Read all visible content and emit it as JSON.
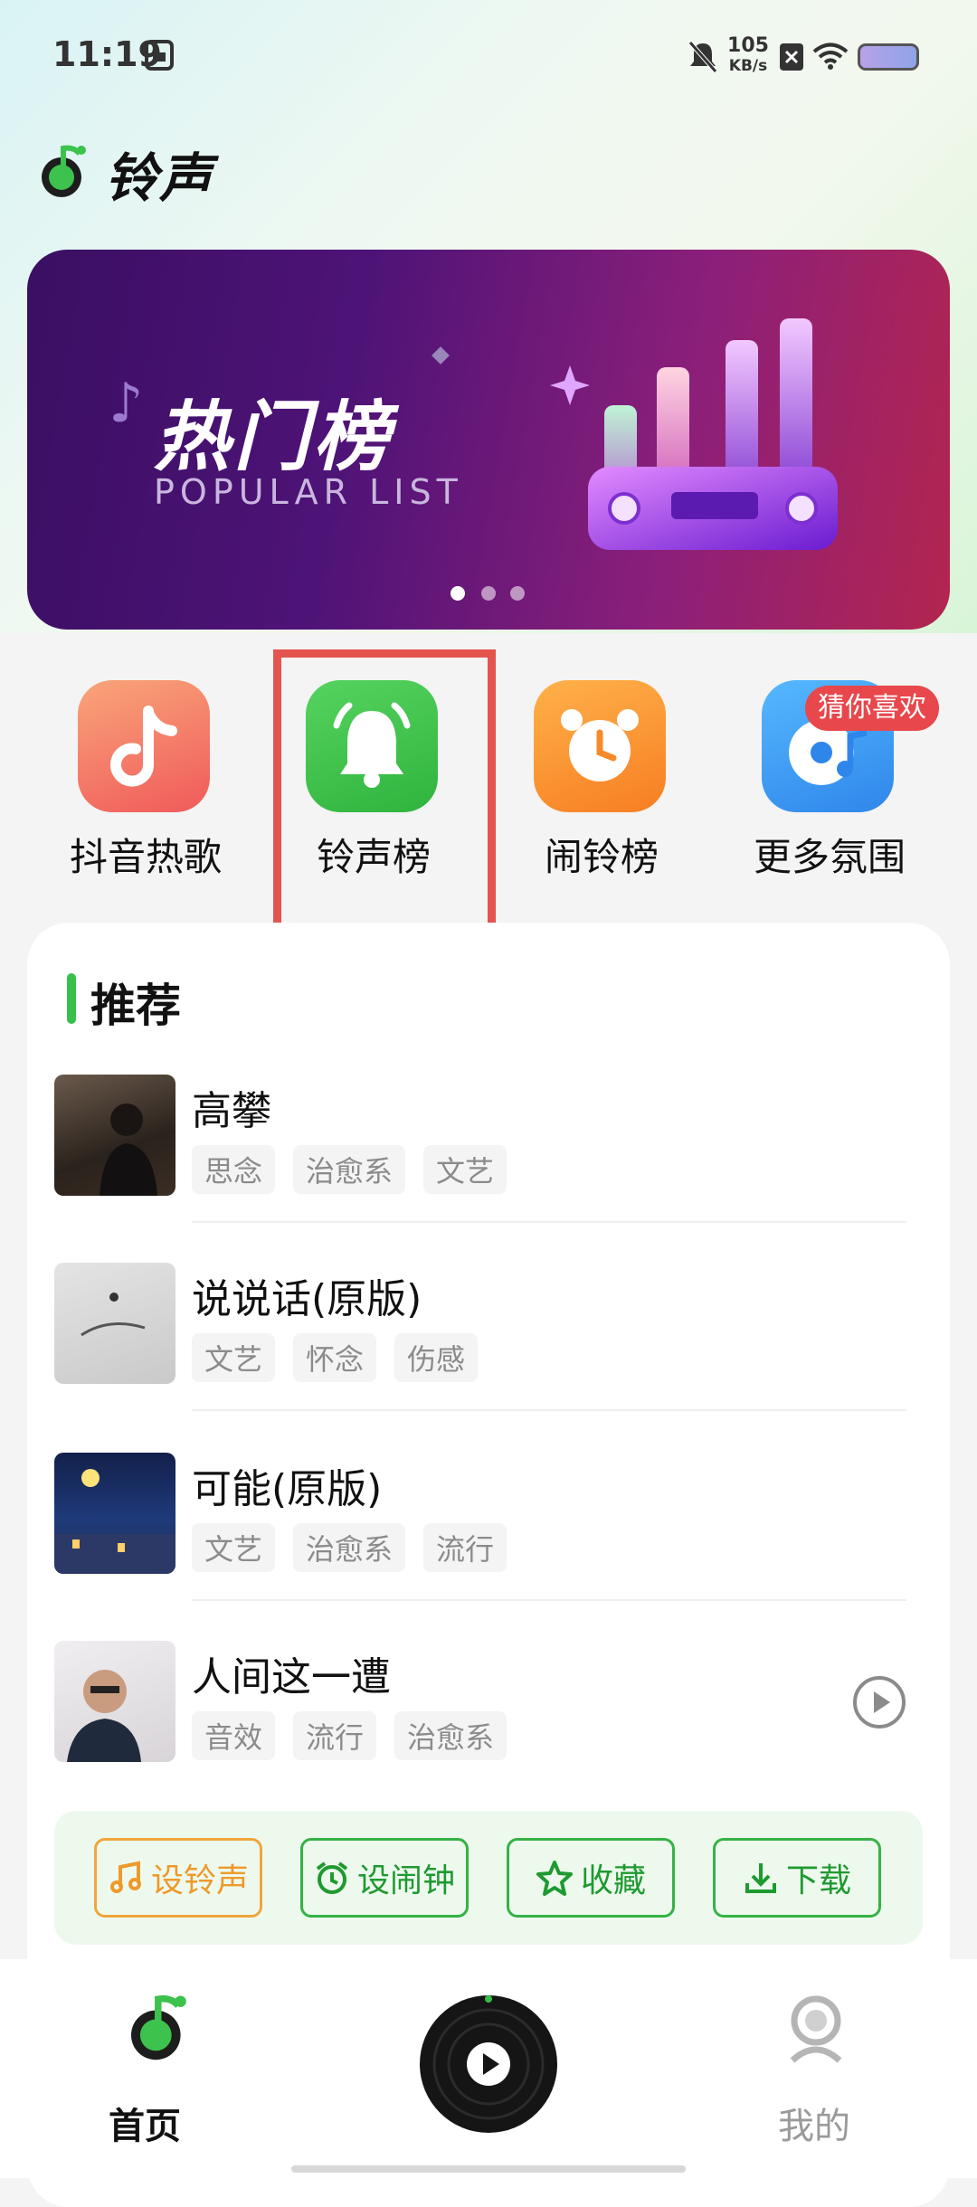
{
  "status_bar": {
    "time": "11:19",
    "net_speed": "105",
    "net_unit": "KB/s",
    "icons": [
      "mute-bell-icon",
      "network-speed",
      "sim-x-icon",
      "wifi-icon",
      "battery-icon"
    ]
  },
  "header": {
    "title": "铃声"
  },
  "banner": {
    "title": "热门榜",
    "subtitle": "POPULAR LIST",
    "page_index": 1,
    "page_count": 3
  },
  "categories": [
    {
      "label": "抖音热歌",
      "icon": "tiktok-note-icon",
      "color": "#f4715f"
    },
    {
      "label": "铃声榜",
      "icon": "bell-icon",
      "color": "#3dc24d"
    },
    {
      "label": "闹铃榜",
      "icon": "alarm-clock-icon",
      "color": "#f78b2a"
    },
    {
      "label": "更多氛围",
      "icon": "music-disc-icon",
      "color": "#3d9cf0",
      "badge": "猜你喜欢"
    }
  ],
  "recommend": {
    "title": "推荐",
    "songs": [
      {
        "title": "高攀",
        "tags": [
          "思念",
          "治愈系",
          "文艺"
        ]
      },
      {
        "title": "说说话(原版)",
        "tags": [
          "文艺",
          "怀念",
          "伤感"
        ]
      },
      {
        "title": "可能(原版)",
        "tags": [
          "文艺",
          "治愈系",
          "流行"
        ]
      },
      {
        "title": "人间这一遭",
        "tags": [
          "音效",
          "流行",
          "治愈系"
        ]
      }
    ]
  },
  "actions": [
    {
      "label": "设铃声",
      "icon": "music-note-icon"
    },
    {
      "label": "设闹钟",
      "icon": "alarm-clock-icon"
    },
    {
      "label": "收藏",
      "icon": "star-icon"
    },
    {
      "label": "下载",
      "icon": "download-icon"
    }
  ],
  "bottom_nav": {
    "home": "首页",
    "mine": "我的"
  },
  "colors": {
    "accent": "#37c04a",
    "highlight_box": "#e4544f",
    "badge": "#e8474c"
  }
}
